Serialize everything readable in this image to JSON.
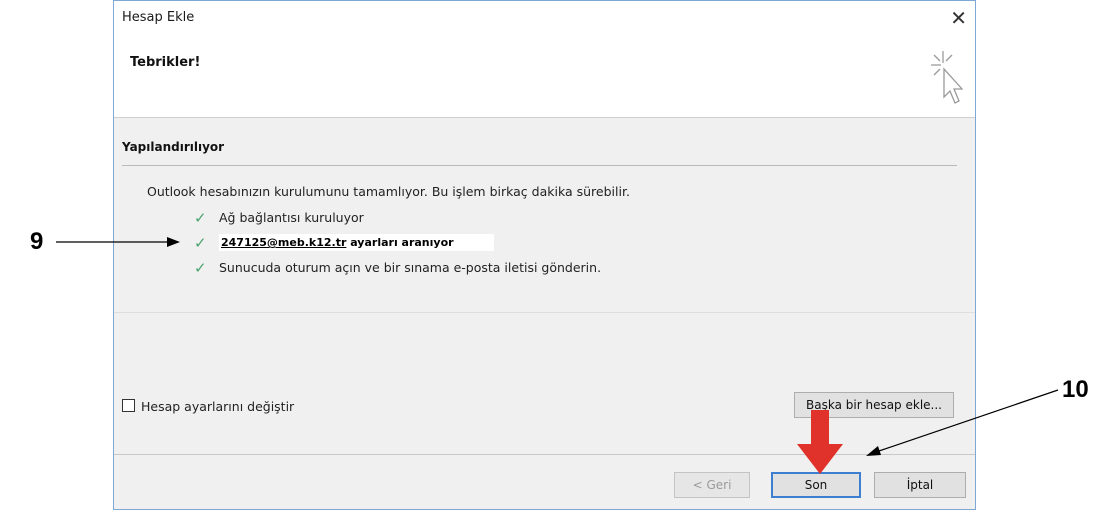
{
  "window": {
    "title": "Hesap Ekle",
    "close_glyph": "✕"
  },
  "header": {
    "title": "Tebrikler!"
  },
  "section": {
    "title": "Yapılandırılıyor"
  },
  "status": {
    "text": "Outlook hesabınızın kurulumunu tamamlıyor. Bu işlem birkaç dakika sürebilir.",
    "steps": [
      {
        "label": "Ağ bağlantısı kuruluyor",
        "icon": "check-icon"
      },
      {
        "email": "247125@meb.k12.tr",
        "suffix": " ayarları aranıyor",
        "icon": "check-icon"
      },
      {
        "label": "Sunucuda oturum açın ve bir sınama e-posta iletisi gönderin.",
        "icon": "check-icon"
      }
    ]
  },
  "options": {
    "change_settings_label": "Hesap ayarlarını değiştir",
    "change_settings_checked": false
  },
  "buttons": {
    "add_another": "Başka bir hesap ekle...",
    "back": "< Geri",
    "finish": "Son",
    "cancel": "İptal"
  },
  "annotations": {
    "callout_9": "9",
    "callout_10": "10"
  },
  "colors": {
    "check": "#4aa36c",
    "arrow_red": "#e0312b",
    "dialog_border": "#7fa8d6",
    "default_button_border": "#3c7fd0"
  }
}
